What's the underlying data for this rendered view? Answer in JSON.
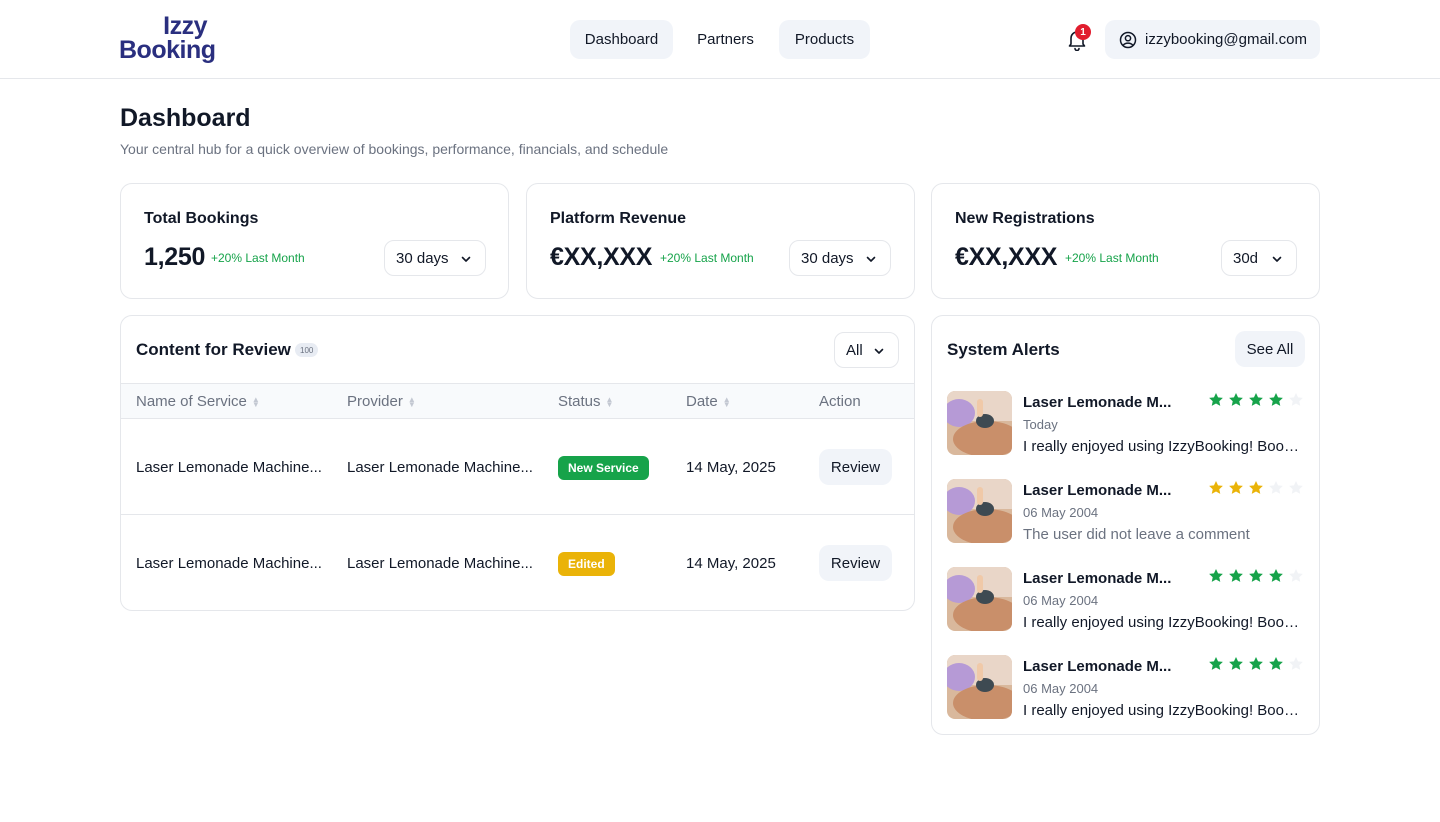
{
  "header": {
    "logo_line1": "Izzy",
    "logo_line2": "Booking",
    "nav": [
      {
        "label": "Dashboard",
        "active": true
      },
      {
        "label": "Partners",
        "active": false
      },
      {
        "label": "Products",
        "active": true
      }
    ],
    "notifications_count": "1",
    "account_email": "izzybooking@gmail.com"
  },
  "page": {
    "title": "Dashboard",
    "subtitle": "Your central hub for a quick overview of bookings, performance, financials, and schedule"
  },
  "kpis": [
    {
      "label": "Total Bookings",
      "value": "1,250",
      "change": "+20% Last Month",
      "period": "30 days"
    },
    {
      "label": "Platform Revenue",
      "value": "€XX,XXX",
      "change": "+20% Last Month",
      "period": "30 days"
    },
    {
      "label": "New Registrations",
      "value": "€XX,XXX",
      "change": "+20% Last Month",
      "period": "30d"
    }
  ],
  "review": {
    "title": "Content for Review",
    "count": "100",
    "filter": "All",
    "columns": [
      "Name of Service",
      "Provider",
      "Status",
      "Date",
      "Action"
    ],
    "rows": [
      {
        "service": "Laser Lemonade Machine...",
        "provider": "Laser Lemonade Machine...",
        "status": "New Service",
        "status_color": "#16a34a",
        "date": "14 May, 2025",
        "action": "Review"
      },
      {
        "service": "Laser Lemonade Machine...",
        "provider": "Laser Lemonade Machine...",
        "status": "Edited",
        "status_color": "#eab308",
        "date": "14 May, 2025",
        "action": "Review"
      }
    ]
  },
  "alerts": {
    "title": "System Alerts",
    "see_all": "See All",
    "star_color_green": "#16a34a",
    "star_color_yellow": "#eab308",
    "items": [
      {
        "name": "Laser Lemonade M...",
        "date": "Today",
        "comment": "I really enjoyed using IzzyBooking! Booke...",
        "rating": 4,
        "star_color": "#16a34a"
      },
      {
        "name": "Laser Lemonade M...",
        "date": "06 May 2004",
        "comment": "The user did not leave a comment",
        "rating": 3,
        "star_color": "#eab308"
      },
      {
        "name": "Laser Lemonade M...",
        "date": "06 May 2004",
        "comment": "I really enjoyed using IzzyBooking! Booke...",
        "rating": 4,
        "star_color": "#16a34a"
      },
      {
        "name": "Laser Lemonade M...",
        "date": "06 May 2004",
        "comment": "I really enjoyed using IzzyBooking! Booke...",
        "rating": 4,
        "star_color": "#16a34a"
      }
    ]
  }
}
